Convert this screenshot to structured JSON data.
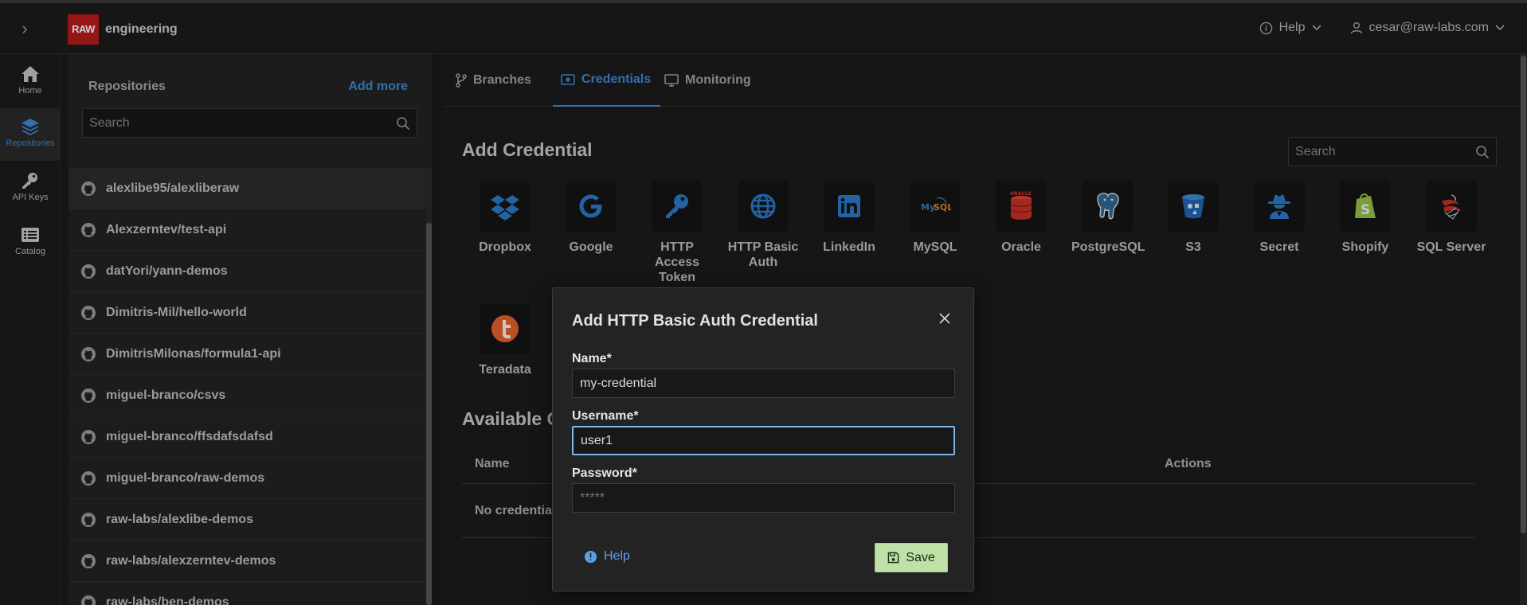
{
  "topbar": {
    "org_name": "engineering",
    "logo_text": "RAW",
    "help_label": "Help",
    "user_email": "cesar@raw-labs.com"
  },
  "nav": {
    "items": [
      {
        "label": "Home",
        "icon": "home-icon"
      },
      {
        "label": "Repositories",
        "icon": "layers-icon"
      },
      {
        "label": "API Keys",
        "icon": "key-icon"
      },
      {
        "label": "Catalog",
        "icon": "list-icon"
      }
    ],
    "active": "Repositories"
  },
  "repos": {
    "title": "Repositories",
    "add_more": "Add more",
    "search_placeholder": "Search",
    "items": [
      "alexlibe95/alexliberaw",
      "Alexzerntev/test-api",
      "datYori/yann-demos",
      "Dimitris-Mil/hello-world",
      "DimitrisMilonas/formula1-api",
      "miguel-branco/csvs",
      "miguel-branco/ffsdafsdafsd",
      "miguel-branco/raw-demos",
      "raw-labs/alexlibe-demos",
      "raw-labs/alexzerntev-demos",
      "raw-labs/ben-demos"
    ]
  },
  "tabs": [
    {
      "label": "Branches",
      "icon": "branch-icon"
    },
    {
      "label": "Credentials",
      "icon": "credential-icon"
    },
    {
      "label": "Monitoring",
      "icon": "monitor-icon"
    }
  ],
  "credentials": {
    "title": "Add Credential",
    "search_placeholder": "Search",
    "types": [
      "Dropbox",
      "Google",
      "HTTP Access Token",
      "HTTP Basic Auth",
      "LinkedIn",
      "MySQL",
      "Oracle",
      "PostgreSQL",
      "S3",
      "Secret",
      "Shopify",
      "SQL Server",
      "Teradata"
    ]
  },
  "available": {
    "title": "Available Credentials",
    "col_name": "Name",
    "col_actions": "Actions",
    "empty_text": "No credentials"
  },
  "modal": {
    "title": "Add HTTP Basic Auth Credential",
    "name_label": "Name*",
    "name_value": "my-credential",
    "username_label": "Username*",
    "username_value": "user1",
    "password_label": "Password*",
    "password_placeholder": "*****",
    "help_label": "Help",
    "save_label": "Save"
  },
  "colors": {
    "accent": "#3f88d6",
    "logo_red": "#b71c1c",
    "save_green": "#bfe0a6"
  }
}
